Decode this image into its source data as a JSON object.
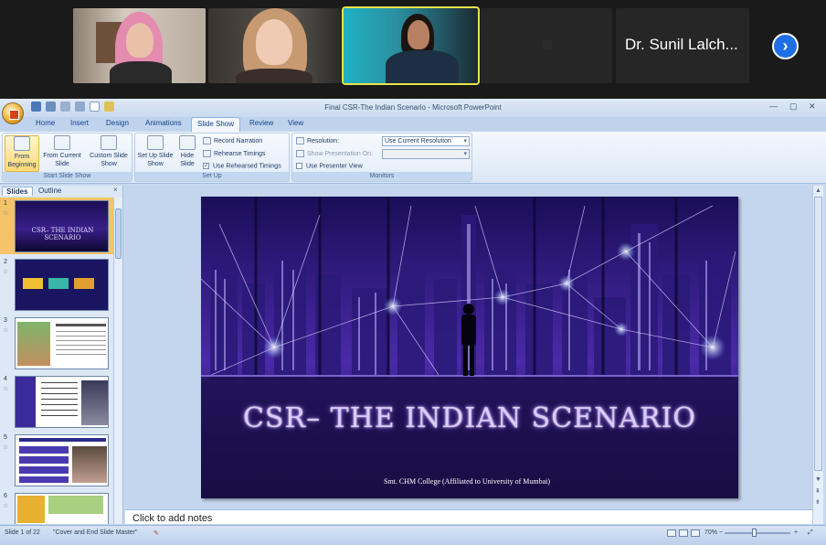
{
  "zoom": {
    "participants": [
      {
        "id": "p1",
        "kind": "video"
      },
      {
        "id": "p2",
        "kind": "video"
      },
      {
        "id": "p3",
        "kind": "video",
        "active": true
      },
      {
        "id": "p4",
        "kind": "muted-video"
      },
      {
        "id": "p5",
        "kind": "name",
        "name": "Dr. Sunil Lalch..."
      }
    ],
    "next_icon": "chevron-right-icon",
    "active_speaker_color": "#e8e34a"
  },
  "ppt": {
    "window_title": "Final CSR-The Indian Scenario - Microsoft PowerPoint",
    "tabs": [
      "Home",
      "Insert",
      "Design",
      "Animations",
      "Slide Show",
      "Review",
      "View"
    ],
    "selected_tab": "Slide Show",
    "ribbon": {
      "start": {
        "from_beginning": "From Beginning",
        "from_current": "From Current Slide",
        "custom": "Custom Slide Show",
        "label": "Start Slide Show"
      },
      "setup": {
        "set_up": "Set Up Slide Show",
        "hide": "Hide Slide",
        "record": "Record Narration",
        "rehearse": "Rehearse Timings",
        "use_rehearsed": "Use Rehearsed Timings",
        "use_rehearsed_checked": true,
        "label": "Set Up"
      },
      "monitors": {
        "resolution_label": "Resolution:",
        "resolution_value": "Use Current Resolution",
        "show_on_label": "Show Presentation On:",
        "presenter_view": "Use Presenter View",
        "label": "Monitors"
      }
    },
    "panel": {
      "tab_slides": "Slides",
      "tab_outline": "Outline",
      "close": "×",
      "thumbnails": [
        {
          "num": "1",
          "selected": true
        },
        {
          "num": "2"
        },
        {
          "num": "3"
        },
        {
          "num": "4"
        },
        {
          "num": "5"
        },
        {
          "num": "6"
        }
      ]
    },
    "slide": {
      "title": "CSR– THE INDIAN SCENARIO",
      "subtitle": "Smt. CHM College (Affiliated to University of Mumbai)"
    },
    "notes_placeholder": "Click to add notes",
    "status": {
      "slide_of": "Slide 1 of 22",
      "theme": "\"Cover and End Slide Master\"",
      "zoom": "70%"
    },
    "colors": {
      "ribbon_text": "#15428b",
      "selected_thumb": "#f6c36a",
      "slide_bg": "#120a3a"
    }
  }
}
